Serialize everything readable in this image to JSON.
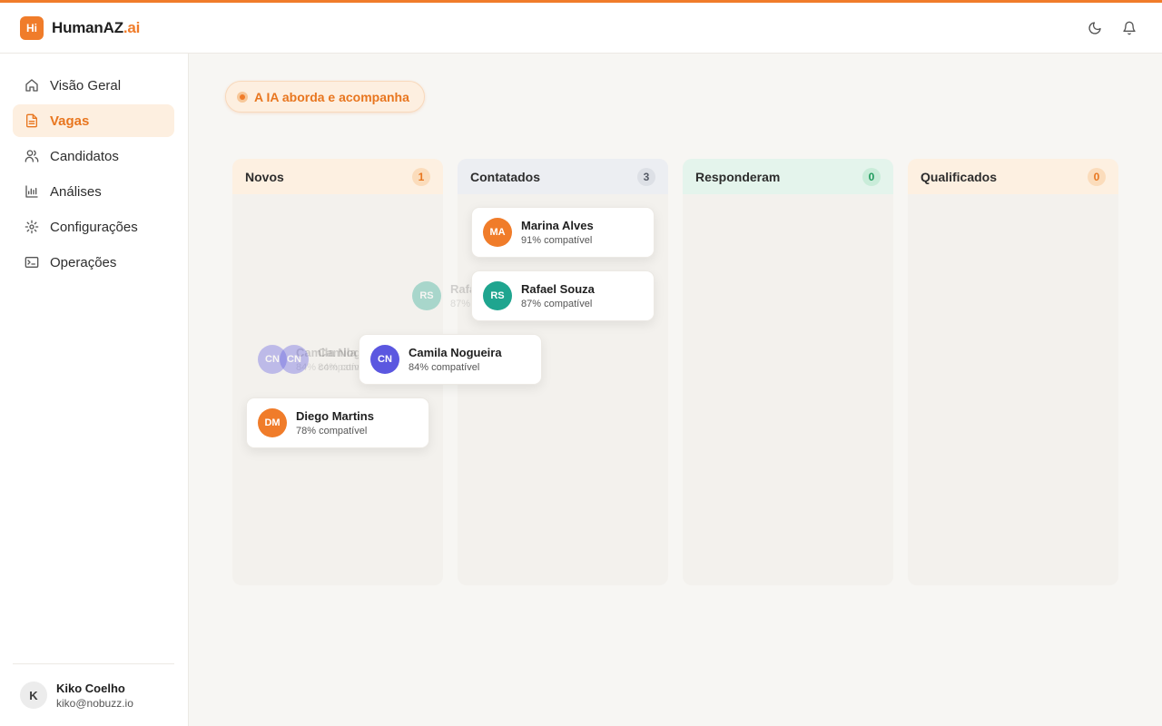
{
  "brand": {
    "logo_text": "Hi",
    "name": "HumanAZ",
    "accent": ".ai",
    "accent_color": "#f07c2a"
  },
  "header": {
    "icons": [
      "moon-icon",
      "bell-icon"
    ]
  },
  "sidebar": {
    "items": [
      {
        "label": "Visão Geral",
        "icon": "home-icon",
        "active": false
      },
      {
        "label": "Vagas",
        "icon": "document-icon",
        "active": true
      },
      {
        "label": "Candidatos",
        "icon": "users-icon",
        "active": false
      },
      {
        "label": "Análises",
        "icon": "chart-icon",
        "active": false
      },
      {
        "label": "Configurações",
        "icon": "gear-icon",
        "active": false
      },
      {
        "label": "Operações",
        "icon": "terminal-icon",
        "active": false
      }
    ],
    "user": {
      "initial": "K",
      "name": "Kiko Coelho",
      "email": "kiko@nobuzz.io"
    }
  },
  "pill": {
    "label": "A IA aborda e acompanha"
  },
  "board": {
    "columns": [
      {
        "title": "Novos",
        "count": "1"
      },
      {
        "title": "Contatados",
        "count": "3"
      },
      {
        "title": "Responderam",
        "count": "0"
      },
      {
        "title": "Qualificados",
        "count": "0"
      }
    ],
    "cards": [
      {
        "initials": "MA",
        "name": "Marina Alves",
        "match": "91% compatível",
        "color": "#f07c2a",
        "column": "Contatados"
      },
      {
        "initials": "RS",
        "name": "Rafael Souza",
        "match": "87% compatível",
        "color": "#1fa58f",
        "column": "Contatados"
      },
      {
        "initials": "CN",
        "name": "Camila Nogueira",
        "match": "84% compatível",
        "color": "#5b57e0",
        "column": "Contatados"
      },
      {
        "initials": "DM",
        "name": "Diego Martins",
        "match": "78% compatível",
        "color": "#f07c2a",
        "column": "Novos"
      }
    ]
  }
}
